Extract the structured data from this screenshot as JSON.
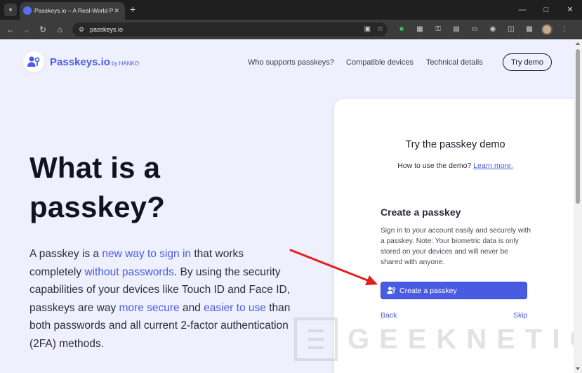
{
  "browser": {
    "tab_title": "Passkeys.io – A Real-World Pa",
    "url": "passkeys.io"
  },
  "site": {
    "brand": "Passkeys.io",
    "by": "by HANKO",
    "nav": [
      "Who supports passkeys?",
      "Compatible devices",
      "Technical details"
    ],
    "cta": "Try demo"
  },
  "hero": {
    "title_line1": "What is a",
    "title_line2": "passkey?",
    "body": [
      {
        "t": "A passkey is a ",
        "hl": false
      },
      {
        "t": "new way to sign in",
        "hl": true
      },
      {
        "t": " that works completely ",
        "hl": false
      },
      {
        "t": "without passwords",
        "hl": true
      },
      {
        "t": ". By using the security capabilities of your devices like Touch ID and Face ID, passkeys are way ",
        "hl": false
      },
      {
        "t": "more secure",
        "hl": true
      },
      {
        "t": " and ",
        "hl": false
      },
      {
        "t": "easier to use",
        "hl": true
      },
      {
        "t": " than both passwords and all current 2-factor authentication (2FA) methods.",
        "hl": false
      }
    ]
  },
  "demo": {
    "title": "Try the passkey demo",
    "howto": "How to use the demo?",
    "learn_more": "Learn more.",
    "section_title": "Create a passkey",
    "section_text": "Sign in to your account easily and securely with a passkey. Note: Your biometric data is only stored on your devices and will never be shared with anyone.",
    "create_button": "Create a passkey",
    "back": "Back",
    "skip": "Skip"
  },
  "watermark": "GEEKNETIC",
  "colors": {
    "accent": "#4a5be3",
    "page_bg": "#eff0fe",
    "arrow": "#e0201c"
  }
}
